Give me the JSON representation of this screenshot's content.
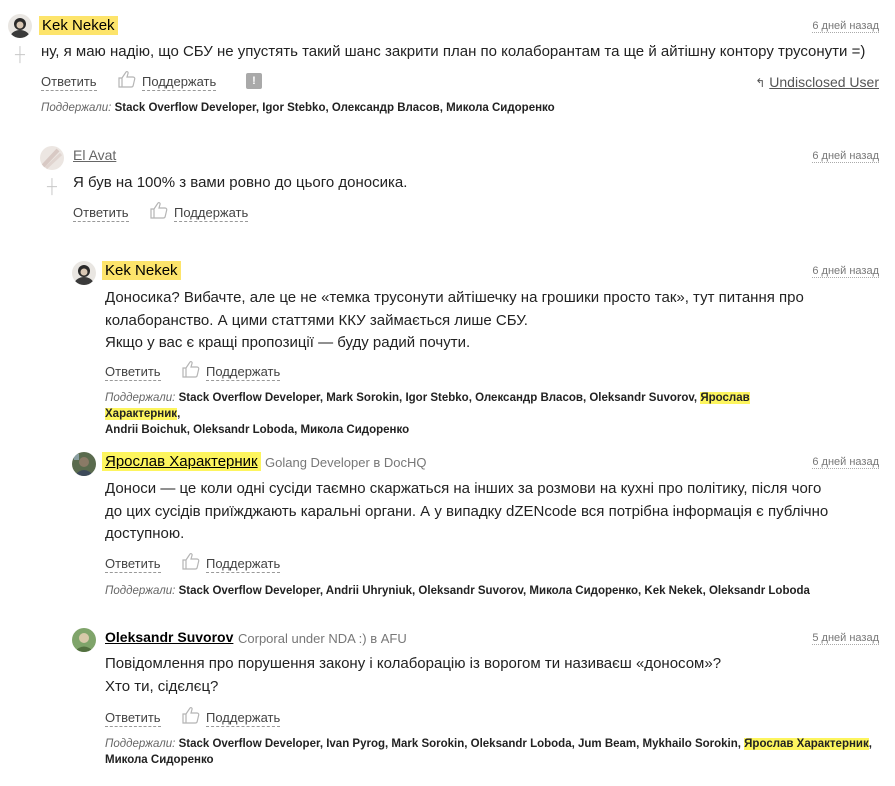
{
  "comments": [
    {
      "author": "Kek Nekek",
      "date": "6 дней назад",
      "text": [
        "ну, я маю надію, що СБУ не упустять такий шанс закрити план по колаборантам та ще й айтішну контору трусонути =)"
      ],
      "reply_label": "Ответить",
      "support_label": "Поддержать",
      "report_glyph": "!",
      "sender_name": "Undisclosed User",
      "supporters_label": "Поддержали:",
      "supporters": "Stack Overflow Developer, Igor Stebko, Олександр Власов, Микола Сидоренко"
    },
    {
      "author": "El Avat",
      "date": "6 дней назад",
      "text": [
        "Я був на 100% з вами ровно до цього доносика."
      ],
      "reply_label": "Ответить",
      "support_label": "Поддержать"
    },
    {
      "author": "Kek Nekek",
      "date": "6 дней назад",
      "text": [
        "Доносика? Вибачте, але це не «темка трусонути айтішечку на грошики просто так», тут питання про",
        "колаборанство. А цими статтями ККУ займається лише СБУ.",
        "Якщо у вас є кращі пропозиції — буду радий почути."
      ],
      "reply_label": "Ответить",
      "support_label": "Поддержать",
      "supporters_label": "Поддержали:",
      "supporters_a": "Stack Overflow Developer, Mark Sorokin, Igor Stebko, Олександр Власов, Oleksandr Suvorov,",
      "supporters_hl": "Ярослав Характерник",
      "supporters_b": ",",
      "supporters_line2": "Andrii Boichuk, Oleksandr Loboda, Микола Сидоренко"
    },
    {
      "author": "Ярослав Характерник",
      "role": "Golang Developer в DocHQ",
      "date": "6 дней назад",
      "text": [
        "Доноси — це коли одні сусіди таємно скаржаться на інших за розмови на кухні про політику, після чого",
        "до цих сусідів приїжджають каральні органи. А у випадку dZENcode вся потрібна інформація є публічно",
        "доступною."
      ],
      "reply_label": "Ответить",
      "support_label": "Поддержать",
      "supporters_label": "Поддержали:",
      "supporters": "Stack Overflow Developer, Andrii Uhryniuk, Oleksandr Suvorov, Микола Сидоренко, Kek Nekek, Oleksandr Loboda"
    },
    {
      "author": "Oleksandr Suvorov",
      "role": "Corporal under NDA :) в AFU",
      "date": "5 дней назад",
      "text": [
        "Повідомлення про порушення закону і колаборацію із ворогом ти називаєш «доносом»?",
        "Хто ти, сідєлєц?"
      ],
      "reply_label": "Ответить",
      "support_label": "Поддержать",
      "supporters_label": "Поддержали:",
      "supporters_a": "Stack Overflow Developer, Ivan Pyrog, Mark Sorokin, Oleksandr Loboda, Jum Beam, Mykhailo Sorokin,",
      "supporters_hl": "Ярослав Характерник",
      "supporters_b": ",",
      "supporters_line2": "Микола Сидоренко"
    }
  ],
  "icons": {
    "avatar": "user-avatar",
    "like": "thumbs-up-outline-icon",
    "plus": "vote-plus-icon",
    "reply_arrow": "reply-arrow-icon"
  },
  "colors": {
    "highlight": "#fde46b",
    "highlight_name": "#fdf55e",
    "muted": "#777777"
  }
}
